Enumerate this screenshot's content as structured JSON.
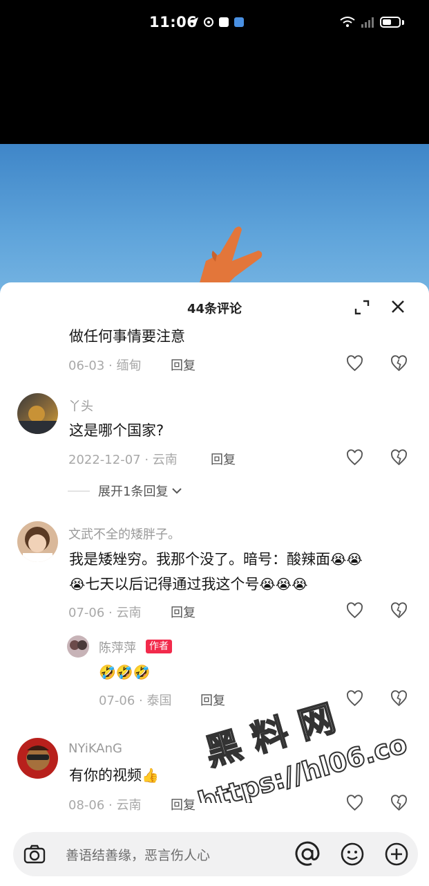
{
  "status": {
    "time": "11:06"
  },
  "header": {
    "title": "44条评论"
  },
  "comments": [
    {
      "text": "做任何事情要注意",
      "meta": "06-03 · 缅甸",
      "reply": "回复"
    },
    {
      "user": "丫头",
      "text": "这是哪个国家?",
      "meta": "2022-12-07 · 云南",
      "reply": "回复",
      "expand": "展开1条回复"
    },
    {
      "user": "文武不全的矮胖子。",
      "text_line1": "我是矮矬穷。我那个没了。暗号：酸辣面",
      "text_line2": "七天以后记得通过我这个号",
      "meta": "07-06 · 云南",
      "reply": "回复",
      "reply_item": {
        "user": "陈萍萍",
        "badge": "作者",
        "meta": "07-06 · 泰国",
        "reply": "回复"
      }
    },
    {
      "user": "NYiKAnG",
      "text": "有你的视频",
      "meta": "08-06 · 云南",
      "reply": "回复"
    }
  ],
  "input": {
    "placeholder": "善语结善缘，恶言伤人心"
  },
  "watermark": {
    "line1": "黑 料 网",
    "line2": "https://hl06.co"
  },
  "colors": {
    "accent": "#f22a4b",
    "sky": "#5ea3da"
  },
  "icons": [
    "send-icon",
    "signal-icon",
    "wifi-icon",
    "battery-icon",
    "expand-icon",
    "close-icon",
    "heart-icon",
    "broken-heart-icon",
    "camera-icon",
    "at-icon",
    "smile-icon",
    "plus-icon"
  ]
}
